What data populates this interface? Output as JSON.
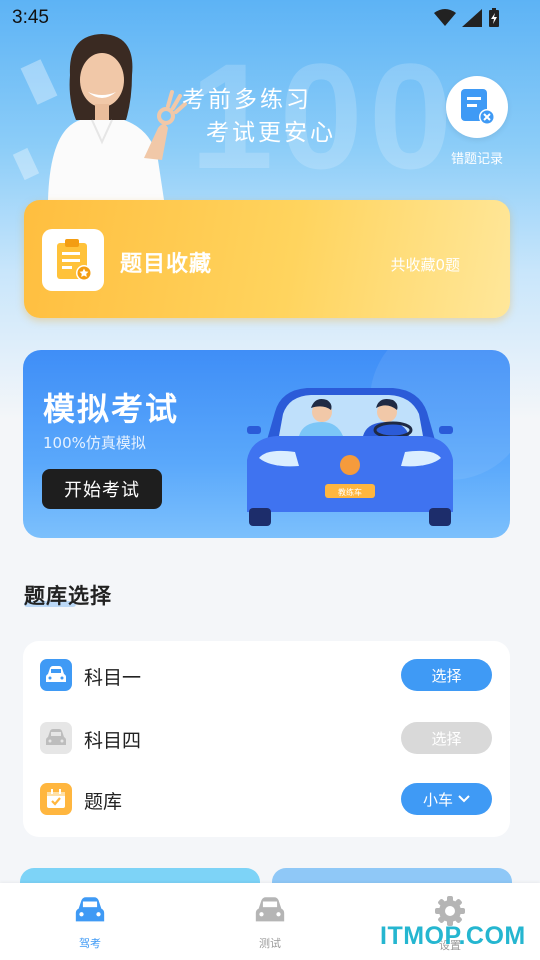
{
  "status_bar": {
    "time": "3:45"
  },
  "hero": {
    "slogan_line1": "考前多练习",
    "slogan_line2": "考试更安心",
    "wrong_records_label": "错题记录",
    "background_number": "100"
  },
  "favorites_card": {
    "title": "题目收藏",
    "count_text": "共收藏0题"
  },
  "mock_exam_card": {
    "title": "模拟考试",
    "subtitle": "100%仿真模拟",
    "start_button": "开始考试",
    "car_plate": "教练车"
  },
  "question_bank": {
    "section_title": "题库选择",
    "rows": [
      {
        "label": "科目一",
        "action": "选择",
        "icon": "car-icon",
        "enabled": true
      },
      {
        "label": "科目四",
        "action": "选择",
        "icon": "car-icon",
        "enabled": false
      },
      {
        "label": "题库",
        "action": "小车",
        "icon": "calendar-check-icon",
        "enabled": true
      }
    ]
  },
  "bottom_nav": {
    "items": [
      {
        "label": "驾考",
        "icon": "car-icon",
        "active": true
      },
      {
        "label": "测试",
        "icon": "car-icon",
        "active": false
      },
      {
        "label": "设置",
        "icon": "gear-icon",
        "active": false
      }
    ]
  },
  "watermark": "ITMOP.COM",
  "colors": {
    "accent_blue": "#3f9af5",
    "favorites_orange": "#ffbe3f",
    "disabled_gray": "#d9d9d9",
    "nav_active": "#3f9af5",
    "nav_inactive": "#999999"
  }
}
